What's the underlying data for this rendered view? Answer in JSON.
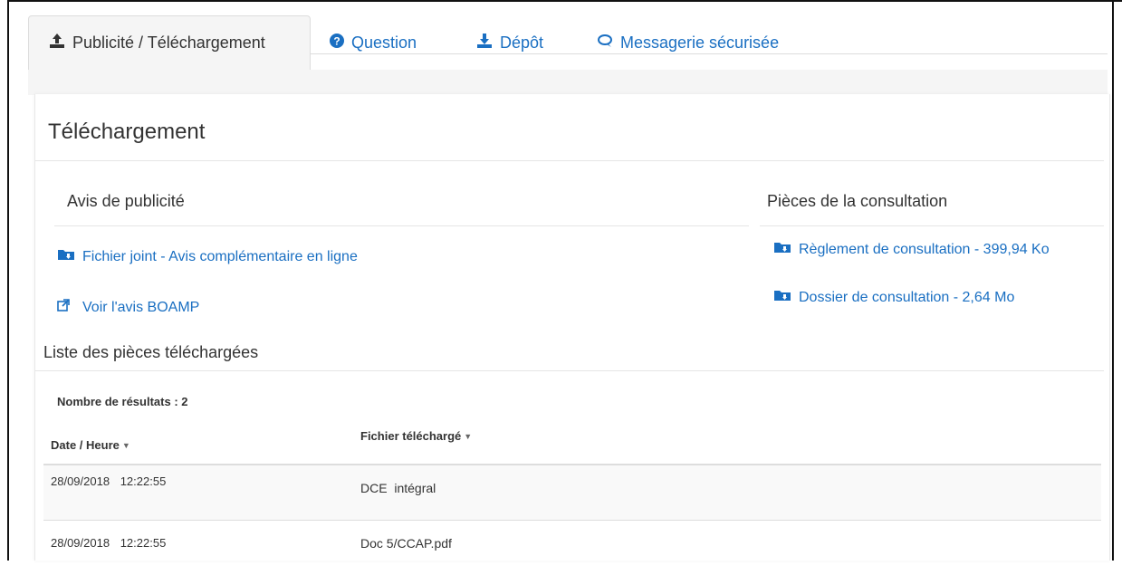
{
  "tabs": [
    {
      "label": "Publicité / Téléchargement",
      "icon": "upload-icon",
      "active": true
    },
    {
      "label": "Question",
      "icon": "question-circle-icon",
      "active": false
    },
    {
      "label": "Dépôt",
      "icon": "download-icon",
      "active": false
    },
    {
      "label": "Messagerie sécurisée",
      "icon": "chat-icon",
      "active": false
    }
  ],
  "panel": {
    "title": "Téléchargement"
  },
  "avis": {
    "title": "Avis de publicité",
    "links": [
      {
        "label": "Fichier joint - Avis complémentaire en ligne",
        "icon": "folder-download-icon"
      },
      {
        "label": "Voir l'avis BOAMP",
        "icon": "external-link-icon"
      }
    ]
  },
  "pieces": {
    "title": "Pièces de la consultation",
    "links": [
      {
        "label": "Règlement de consultation - 399,94 Ko",
        "icon": "folder-download-icon"
      },
      {
        "label": "Dossier de consultation - 2,64 Mo",
        "icon": "folder-download-icon"
      }
    ]
  },
  "downloads": {
    "title": "Liste des pièces téléchargées",
    "count_label": "Nombre de résultats : 2",
    "columns": [
      "Date / Heure",
      "Fichier téléchargé"
    ],
    "rows": [
      {
        "date": "28/09/2018",
        "time": "12:22:55",
        "file": "DCE  intégral"
      },
      {
        "date": "28/09/2018",
        "time": "12:22:55",
        "file": "Doc 5/CCAP.pdf"
      }
    ]
  },
  "colors": {
    "link": "#1a6fc2",
    "text": "#333333",
    "tab_active_bg": "#f5f5f5"
  }
}
